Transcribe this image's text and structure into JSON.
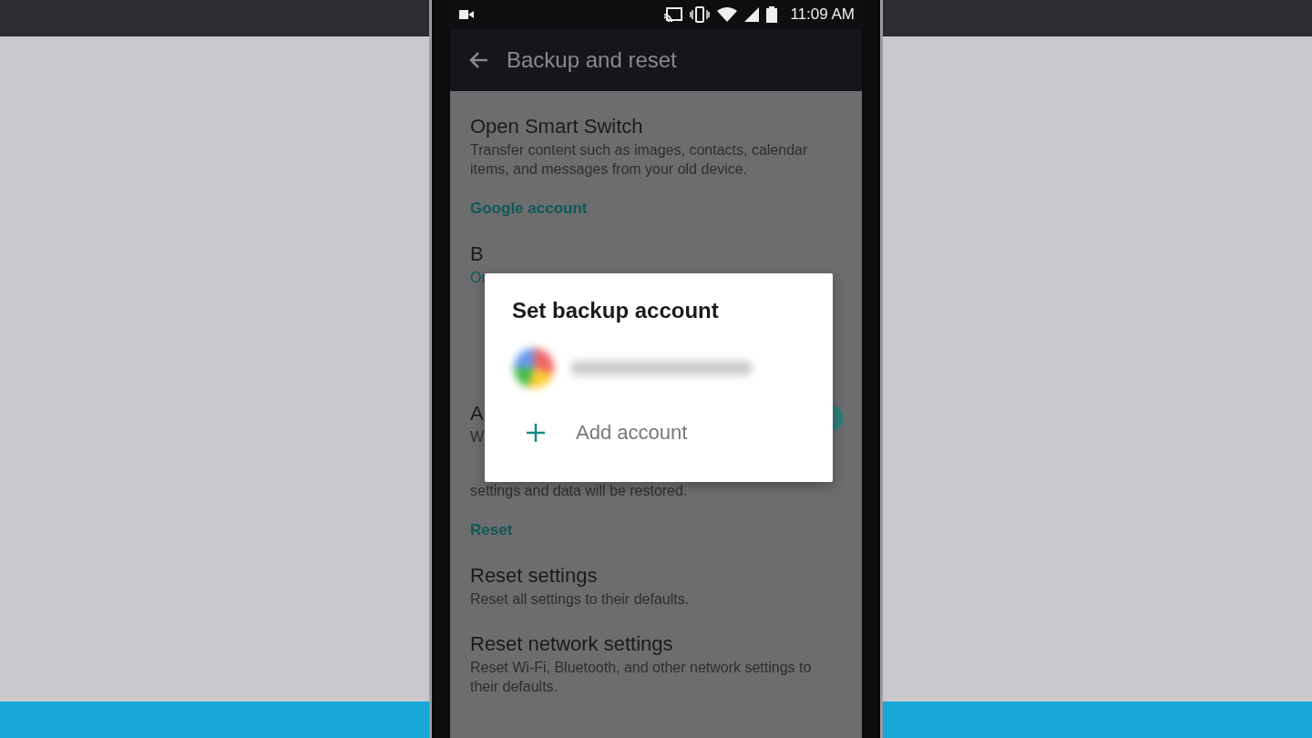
{
  "status_bar": {
    "time": "11:09 AM"
  },
  "app_bar": {
    "title": "Backup and reset"
  },
  "list": [
    {
      "kind": "item",
      "title": "Open Smart Switch",
      "subtitle": "Transfer content such as images, contacts, calendar items, and messages from your old device."
    },
    {
      "kind": "header",
      "title": "Google account"
    },
    {
      "kind": "item",
      "title": "B",
      "subtitle": "Or",
      "subtitle_accent": true
    },
    {
      "kind": "gap"
    },
    {
      "kind": "item",
      "title": "A",
      "subtitle": "W",
      "subtitle2": "settings and data will be restored.",
      "switch_on": true
    },
    {
      "kind": "header",
      "title": "Reset"
    },
    {
      "kind": "item",
      "title": "Reset settings",
      "subtitle": "Reset all settings to their defaults."
    },
    {
      "kind": "item",
      "title": "Reset network settings",
      "subtitle": "Reset Wi-Fi, Bluetooth, and other network settings to their defaults."
    }
  ],
  "dialog": {
    "title": "Set backup account",
    "add_label": "Add account"
  }
}
